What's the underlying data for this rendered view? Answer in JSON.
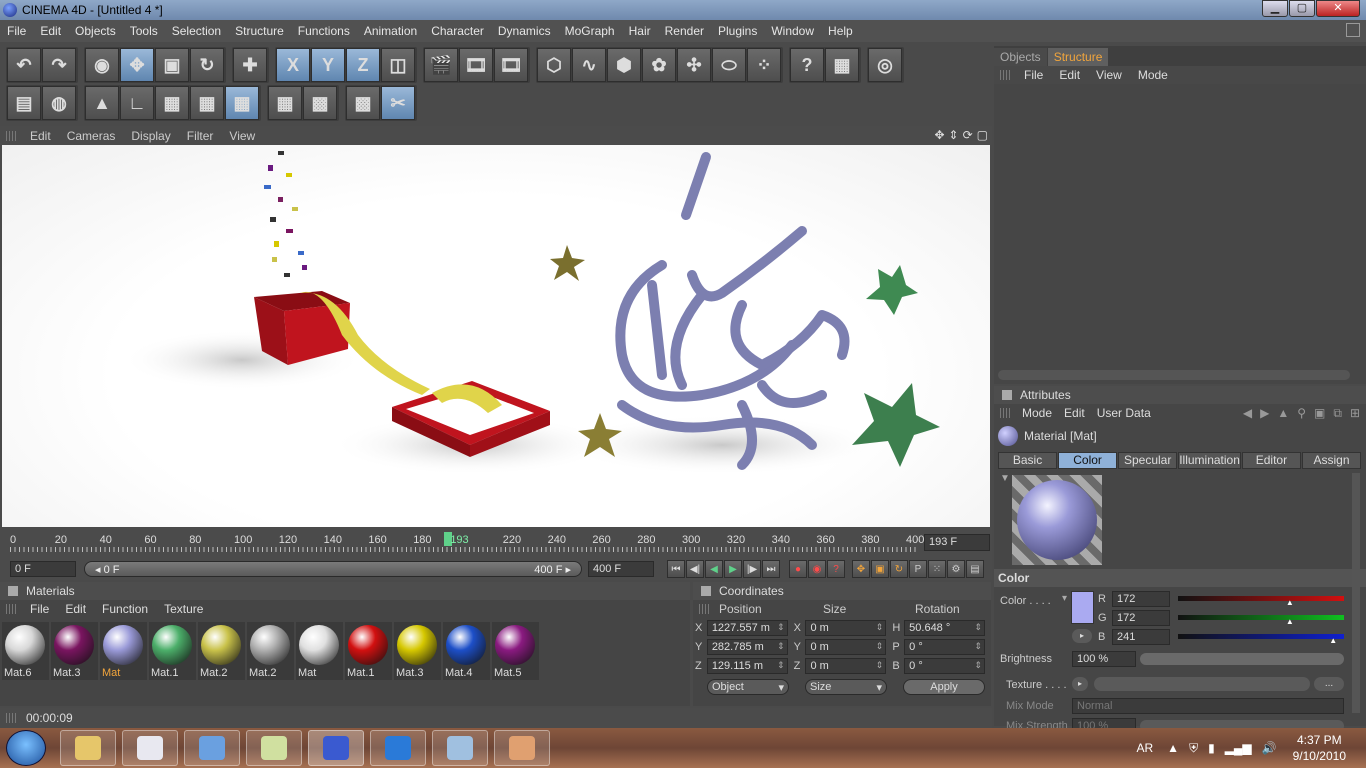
{
  "window": {
    "title": "CINEMA 4D - [Untitled 4 *]"
  },
  "menu": [
    "File",
    "Edit",
    "Objects",
    "Tools",
    "Selection",
    "Structure",
    "Functions",
    "Animation",
    "Character",
    "Dynamics",
    "MoGraph",
    "Hair",
    "Render",
    "Plugins",
    "Window",
    "Help"
  ],
  "toolbar1_icons": [
    "undo-icon",
    "redo-icon",
    "live-select-icon",
    "move-icon",
    "scale-icon",
    "rotate-icon",
    "world-move-icon",
    "x-axis-icon",
    "y-axis-icon",
    "z-axis-icon",
    "coordinate-system-icon",
    "render-view-icon",
    "render-picture-viewer-icon",
    "render-settings-icon",
    "cube-icon",
    "spline-icon",
    "nurbs-icon",
    "array-icon",
    "deformer-icon",
    "scene-icon",
    "particle-icon",
    "help-icon",
    "layer-browser-icon",
    "web-icon"
  ],
  "toolbar1_glyphs": [
    "↶",
    "↷",
    "◉",
    "✥",
    "▣",
    "↻",
    "✚",
    "X",
    "Y",
    "Z",
    "◫",
    "🎬",
    "🎞",
    "🎞",
    "⬡",
    "∿",
    "⬢",
    "✿",
    "✣",
    "⬭",
    "⁘",
    "?",
    "▦",
    "◎"
  ],
  "toolbar2_icons": [
    "layout-icon",
    "sculpt-icon",
    "model-tool-icon",
    "axis-tool-icon",
    "points-mode-icon",
    "edges-mode-icon",
    "polygons-mode-icon",
    "object-mode-icon",
    "texture-mode-icon",
    "workplane-icon",
    "snap-icon"
  ],
  "toolbar2_glyphs": [
    "▤",
    "◍",
    "▲",
    "∟",
    "▦",
    "▦",
    "▦",
    "▦",
    "▩",
    "▩",
    "✂"
  ],
  "viewport_menu": [
    "Edit",
    "Cameras",
    "Display",
    "Filter",
    "View"
  ],
  "viewport_nav": [
    "✥",
    "⇕",
    "⟳",
    "▢"
  ],
  "timeline": {
    "ticks": [
      "0",
      "20",
      "40",
      "60",
      "80",
      "100",
      "120",
      "140",
      "160",
      "180",
      "193",
      "220",
      "240",
      "260",
      "280",
      "300",
      "320",
      "340",
      "360",
      "380",
      "400"
    ],
    "current_frame": "193 F",
    "start_field": "0 F",
    "slider_left": "◂ 0 F",
    "slider_right": "400 F ▸",
    "end_field": "400 F"
  },
  "transport_glyphs": [
    "⏮",
    "◀|",
    "◀",
    "▶",
    "|▶",
    "⏭"
  ],
  "record_glyphs": [
    "●",
    "◉",
    "?"
  ],
  "key_glyphs": [
    "✥",
    "▣",
    "↻",
    "P",
    "⁙",
    "⚙",
    "▤"
  ],
  "materials": {
    "title": "Materials",
    "menu": [
      "File",
      "Edit",
      "Function",
      "Texture"
    ],
    "items": [
      {
        "label": "Mat.6",
        "color": "#d8d8d8"
      },
      {
        "label": "Mat.3",
        "color": "#7a1560"
      },
      {
        "label": "Mat",
        "color": "#9a9ad8",
        "selected": true
      },
      {
        "label": "Mat.1",
        "color": "#4caf6a"
      },
      {
        "label": "Mat.2",
        "color": "#c9c24a"
      },
      {
        "label": "Mat.2",
        "color": "#b0b0b0"
      },
      {
        "label": "Mat",
        "color": "#e0e0e0"
      },
      {
        "label": "Mat.1",
        "color": "#d21010"
      },
      {
        "label": "Mat.3",
        "color": "#d6c800"
      },
      {
        "label": "Mat.4",
        "color": "#1d4fc8"
      },
      {
        "label": "Mat.5",
        "color": "#8a1a80"
      }
    ]
  },
  "coordinates": {
    "title": "Coordinates",
    "headers": [
      "Position",
      "Size",
      "Rotation"
    ],
    "rows": [
      {
        "axis": "X",
        "pos": "1227.557 m",
        "size_axis": "X",
        "size": "0 m",
        "rot_axis": "H",
        "rot": "50.648 °"
      },
      {
        "axis": "Y",
        "pos": "282.785 m",
        "size_axis": "Y",
        "size": "0 m",
        "rot_axis": "P",
        "rot": "0 °"
      },
      {
        "axis": "Z",
        "pos": "129.115 m",
        "size_axis": "Z",
        "size": "0 m",
        "rot_axis": "B",
        "rot": "0 °"
      }
    ],
    "mode_select": "Object",
    "size_select": "Size",
    "apply_label": "Apply"
  },
  "objects_panel": {
    "tabs": [
      "Objects",
      "Structure"
    ],
    "menu": [
      "File",
      "Edit",
      "View",
      "Mode"
    ]
  },
  "attributes": {
    "title": "Attributes",
    "menu": [
      "Mode",
      "Edit",
      "User Data"
    ],
    "material_name": "Material [Mat]",
    "tabs": [
      "Basic",
      "Color",
      "Specular",
      "Illumination",
      "Editor",
      "Assign"
    ],
    "section": "Color",
    "color_label": "Color . . . .",
    "swatch": "#aaaaf1",
    "rgb": [
      {
        "ch": "R",
        "val": "172",
        "color": "#d21010"
      },
      {
        "ch": "G",
        "val": "172",
        "color": "#10c020"
      },
      {
        "ch": "B",
        "val": "241",
        "color": "#1020d0"
      }
    ],
    "brightness_label": "Brightness",
    "brightness_val": "100 %",
    "texture_label": "Texture . . . .",
    "texture_browse": "...",
    "mixmode_label": "Mix Mode",
    "mixmode_val": "Normal",
    "mixstrength_label": "Mix Strength",
    "mixstrength_val": "100 %"
  },
  "status": {
    "time": "00:00:09"
  },
  "scene": {
    "star_colors": [
      "#7a6f2e",
      "#3f8a52"
    ],
    "calligraphy_color": "#7c7fb0",
    "box_color": "#b0121a",
    "ribbon_color": "#e0d44a"
  },
  "taskbar": {
    "lang": "AR",
    "time": "4:37 PM",
    "date": "9/10/2010",
    "items": [
      "explorer-icon",
      "media-player-icon",
      "paint-app-icon",
      "people-icon",
      "cinema4d-icon",
      "ie-icon",
      "picture-icon",
      "palette-icon"
    ]
  }
}
